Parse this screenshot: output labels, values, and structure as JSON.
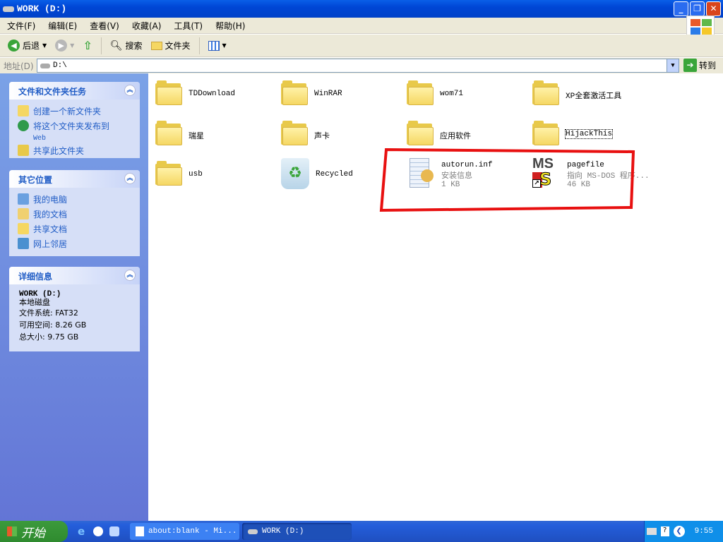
{
  "window": {
    "title": "WORK  (D:)",
    "buttons": [
      "minimize",
      "maximize",
      "close"
    ]
  },
  "menu": [
    "文件(F)",
    "编辑(E)",
    "查看(V)",
    "收藏(A)",
    "工具(T)",
    "帮助(H)"
  ],
  "toolbar": {
    "back": "后退",
    "search": "搜索",
    "folders": "文件夹"
  },
  "address": {
    "label": "地址(D)",
    "value": "D:\\",
    "go": "转到"
  },
  "sidebar": {
    "tasks": {
      "title": "文件和文件夹任务",
      "items": [
        "创建一个新文件夹",
        "将这个文件夹发布到",
        "共享此文件夹"
      ],
      "web": "Web"
    },
    "places": {
      "title": "其它位置",
      "items": [
        "我的电脑",
        "我的文档",
        "共享文档",
        "网上邻居"
      ]
    },
    "details": {
      "title": "详细信息",
      "name": "WORK  (D:)",
      "type": "本地磁盘",
      "fs": "文件系统: FAT32",
      "free": "可用空间: 8.26 GB",
      "total": "总大小: 9.75 GB"
    }
  },
  "files": [
    {
      "name": "TDDownload",
      "icon": "folder"
    },
    {
      "name": "WinRAR",
      "icon": "folder"
    },
    {
      "name": "wom71",
      "icon": "folder"
    },
    {
      "name": "XP全套激活工具",
      "icon": "folder"
    },
    {
      "name": "瑞星",
      "icon": "folder"
    },
    {
      "name": "声卡",
      "icon": "folder"
    },
    {
      "name": "应用软件",
      "icon": "folder"
    },
    {
      "name": "HijackThis",
      "icon": "folder"
    },
    {
      "name": "usb",
      "icon": "folder"
    },
    {
      "name": "Recycled",
      "icon": "recycle-bin"
    },
    {
      "name": "autorun.inf",
      "type": "安装信息",
      "size": "1 KB",
      "icon": "inf-file"
    },
    {
      "name": "pagefile",
      "type": "指向 MS-DOS 程序...",
      "size": "46 KB",
      "icon": "msdos-shortcut"
    }
  ],
  "annotation": {
    "color": "#e81010"
  },
  "taskbar": {
    "start": "开始",
    "tasks": [
      "about:blank - Mi...",
      "WORK (D:)"
    ],
    "clock": "9:55"
  }
}
